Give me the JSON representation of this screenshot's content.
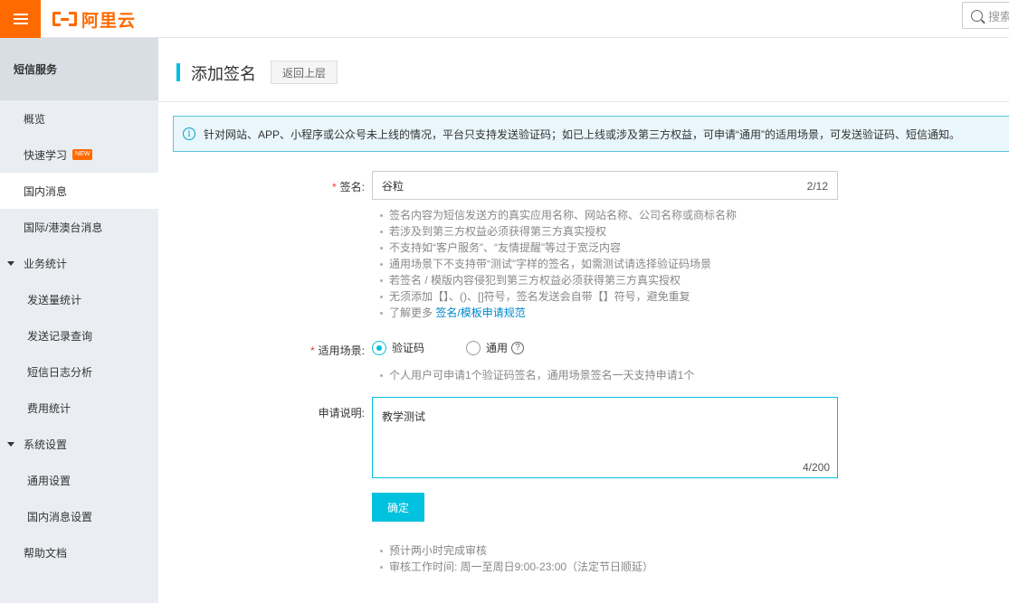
{
  "topbar": {
    "brand": "阿里云",
    "search_placeholder": "搜索"
  },
  "sidebar": {
    "header": "短信服务",
    "items": [
      {
        "label": "概览"
      },
      {
        "label": "快速学习",
        "badge": "NEW"
      },
      {
        "label": "国内消息",
        "active": true
      },
      {
        "label": "国际/港澳台消息"
      },
      {
        "label": "业务统计",
        "group": true
      },
      {
        "label": "发送量统计"
      },
      {
        "label": "发送记录查询"
      },
      {
        "label": "短信日志分析"
      },
      {
        "label": "费用统计"
      },
      {
        "label": "系统设置",
        "group": true
      },
      {
        "label": "通用设置"
      },
      {
        "label": "国内消息设置"
      },
      {
        "label": "帮助文档"
      }
    ]
  },
  "page": {
    "title": "添加签名",
    "back_label": "返回上层",
    "notice": "针对网站、APP、小程序或公众号未上线的情况，平台只支持发送验证码；如已上线或涉及第三方权益，可申请“通用”的适用场景，可发送验证码、短信通知。"
  },
  "form": {
    "signature": {
      "label": "签名:",
      "value": "谷粒",
      "count": "2/12",
      "hints": [
        "签名内容为短信发送方的真实应用名称、网站名称、公司名称或商标名称",
        "若涉及到第三方权益必须获得第三方真实授权",
        "不支持如“客户服务”、“友情提醒”等过于宽泛内容",
        "通用场景下不支持带“测试”字样的签名，如需测试请选择验证码场景",
        "若签名 / 模版内容侵犯到第三方权益必须获得第三方真实授权",
        "无须添加【】、()、[]符号，签名发送会自带【】符号，避免重复"
      ],
      "more_prefix": "了解更多",
      "more_link": "签名/模板申请规范"
    },
    "scene": {
      "label": "适用场景:",
      "options": [
        {
          "label": "验证码",
          "checked": true
        },
        {
          "label": "通用",
          "checked": false
        }
      ],
      "help_glyph": "?",
      "hint": "个人用户可申请1个验证码签名，通用场景签名一天支持申请1个"
    },
    "description": {
      "label": "申请说明:",
      "value": "教学测试",
      "count": "4/200"
    },
    "submit_label": "确定",
    "footer_hints": [
      "预计两小时完成审核",
      "审核工作时间: 周一至周日9:00-23:00（法定节日顺延）"
    ]
  },
  "colors": {
    "brand_orange": "#ff6a00",
    "accent_cyan": "#00c1de",
    "link_blue": "#0088cc",
    "required_red": "#e4393c"
  }
}
